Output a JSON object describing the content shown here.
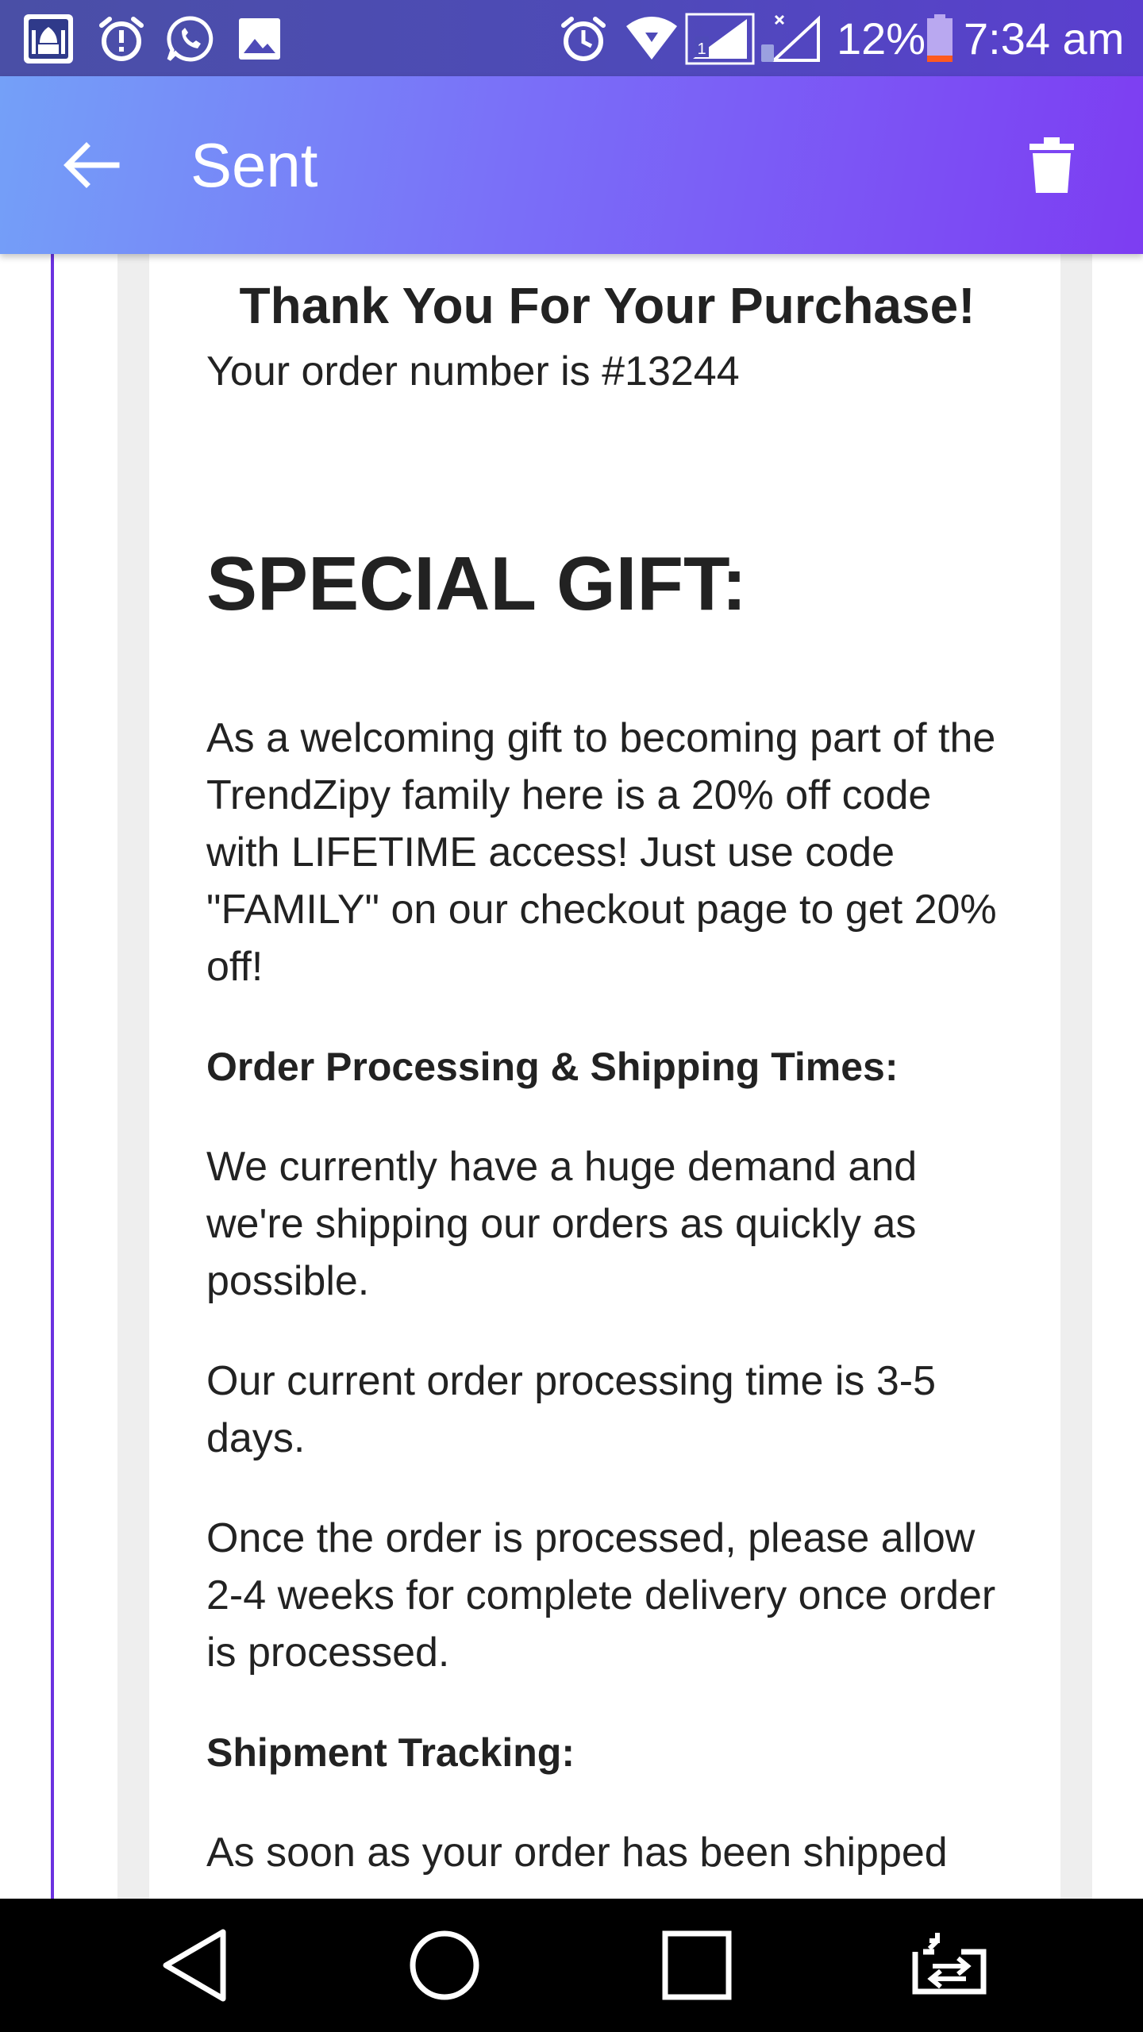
{
  "status_bar": {
    "battery": "12%",
    "time": "7:34 am",
    "icons": [
      "mosque-app-icon",
      "alarm-alert-icon",
      "whatsapp-icon",
      "image-icon",
      "alarm-icon",
      "wifi-icon",
      "signal-sim1-icon",
      "signal-sim2-icon",
      "battery-icon"
    ]
  },
  "app_bar": {
    "title": "Sent",
    "back_icon": "arrow-left-icon",
    "delete_icon": "trash-icon"
  },
  "email": {
    "title": "Thank You For Your Purchase!",
    "order_line": "Your order number is #13244",
    "gift_heading": "SPECIAL GIFT:",
    "gift_text": "As a welcoming gift to becoming part of the TrendZipy family here is a 20% off code with LIFETIME access! Just use code \"FAMILY\" on our checkout page to get 20% off!",
    "processing_heading": "Order Processing & Shipping Times:",
    "processing_p1": "We currently have a huge demand and we're shipping our orders as quickly as possible.",
    "processing_p2": "Our current order processing time is 3-5 days.",
    "processing_p3": "Once the order is processed, please allow 2-4 weeks for complete delivery once order is processed.",
    "tracking_heading": "Shipment Tracking:",
    "tracking_p1": "As soon as your order has been shipped"
  },
  "nav_bar": {
    "icons": [
      "back-triangle-icon",
      "home-circle-icon",
      "recents-square-icon",
      "dual-app-switch-icon"
    ]
  },
  "colors": {
    "status_bar": "#4e4ab8",
    "app_bar_start": "#74a0f8",
    "app_bar_end": "#7d3df2",
    "accent_rule": "#6b32e0",
    "frame_gray": "#eeeeee",
    "text": "#222222"
  }
}
